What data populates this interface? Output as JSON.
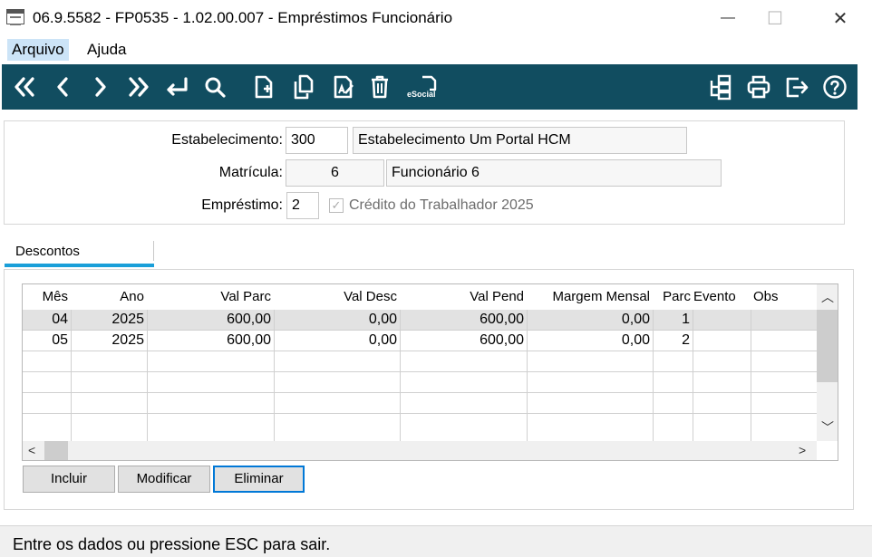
{
  "window": {
    "title": "06.9.5582 - FP0535 - 1.02.00.007 - Empréstimos Funcionário",
    "min_glyph": "—",
    "max_glyph": "☐",
    "close_glyph": "✕"
  },
  "menu": {
    "items": [
      "Arquivo",
      "Ajuda"
    ]
  },
  "toolbar": {
    "color": "#114d60",
    "left_icons": [
      "first-icon",
      "prev-icon",
      "next-icon",
      "last-icon",
      "return-icon",
      "search-icon",
      "new-doc-icon",
      "copy-icon",
      "edit-icon",
      "delete-icon",
      "esocial-icon"
    ],
    "esocial_label": "eSocial",
    "right_icons": [
      "hierarchy-icon",
      "print-icon",
      "exit-icon",
      "help-icon"
    ]
  },
  "form": {
    "estabelecimento_label": "Estabelecimento:",
    "estabelecimento_code": "300",
    "estabelecimento_name": "Estabelecimento Um Portal HCM",
    "matricula_label": "Matrícula:",
    "matricula_code": "6",
    "matricula_name": "Funcionário 6",
    "emprestimo_label": "Empréstimo:",
    "emprestimo_code": "2",
    "credito_label": "Crédito do Trabalhador 2025",
    "credito_checked": true
  },
  "tabs": {
    "descontos": "Descontos"
  },
  "grid": {
    "headers": [
      "Mês",
      "Ano",
      "Val Parc",
      "Val Desc",
      "Val Pend",
      "Margem Mensal",
      "Parc",
      "Evento",
      "Obs"
    ],
    "rows": [
      [
        "04",
        "2025",
        "600,00",
        "0,00",
        "600,00",
        "0,00",
        "1",
        "",
        ""
      ],
      [
        "05",
        "2025",
        "600,00",
        "0,00",
        "600,00",
        "0,00",
        "2",
        "",
        ""
      ]
    ]
  },
  "buttons": {
    "incluir": "Incluir",
    "modificar": "Modificar",
    "eliminar": "Eliminar"
  },
  "status": {
    "message": "Entre os dados ou pressione ESC para sair."
  }
}
